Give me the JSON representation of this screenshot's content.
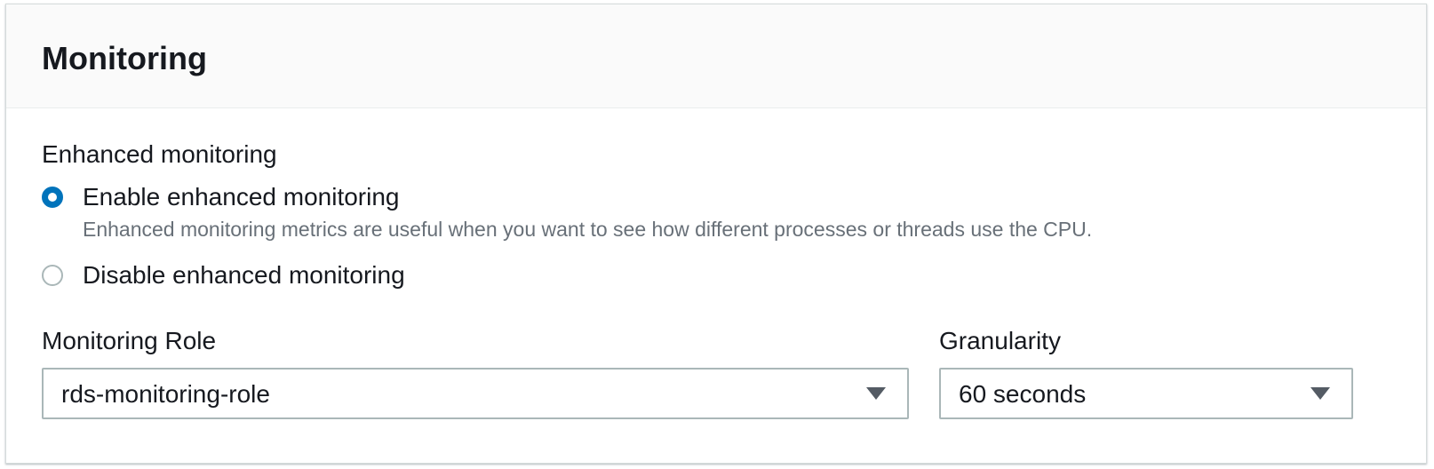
{
  "panel": {
    "title": "Monitoring"
  },
  "enhanced_monitoring": {
    "group_label": "Enhanced monitoring",
    "options": [
      {
        "label": "Enable enhanced monitoring",
        "description": "Enhanced monitoring metrics are useful when you want to see how different processes or threads use the CPU.",
        "checked": true
      },
      {
        "label": "Disable enhanced monitoring",
        "checked": false
      }
    ]
  },
  "monitoring_role": {
    "label": "Monitoring Role",
    "value": "rds-monitoring-role"
  },
  "granularity": {
    "label": "Granularity",
    "value": "60 seconds"
  },
  "colors": {
    "accent": "#0073bb",
    "header_bg": "#fafafa",
    "text": "#16191f",
    "secondary_text": "#687078",
    "border": "#aab7b8"
  },
  "icons": {
    "dropdown": "caret-down-icon"
  }
}
